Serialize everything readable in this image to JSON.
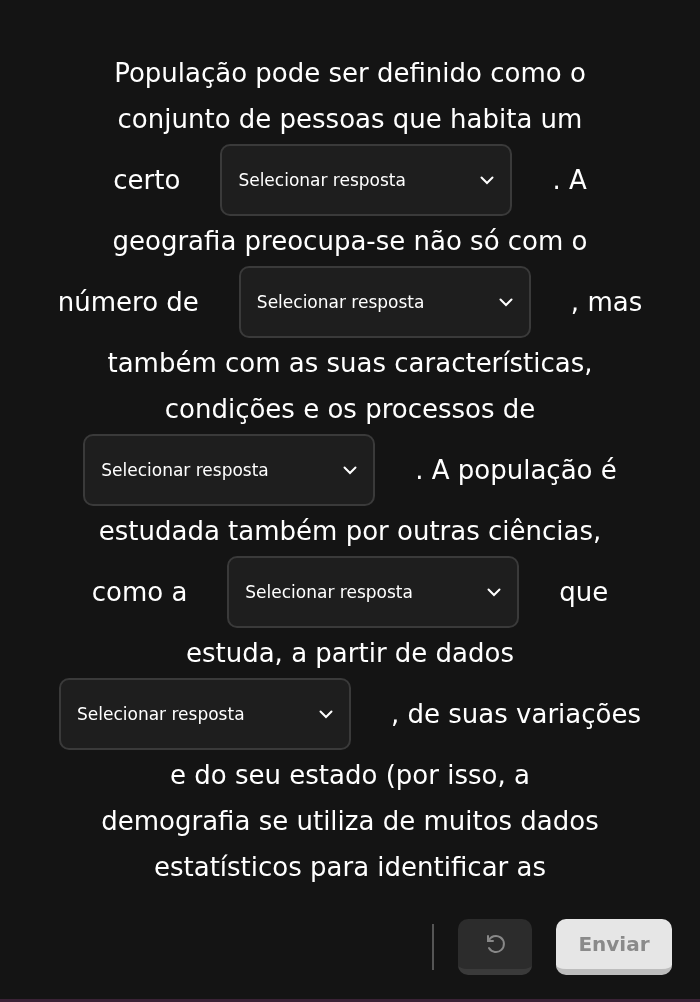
{
  "lines": [
    [
      {
        "kind": "text",
        "text": "População pode ser definido como o"
      }
    ],
    [
      {
        "kind": "text",
        "text": "conjunto de pessoas que habita um"
      }
    ],
    [
      {
        "kind": "text",
        "text": "certo"
      },
      {
        "kind": "dropdown",
        "placeholder": "Selecionar resposta"
      },
      {
        "kind": "text",
        "text": ". A"
      }
    ],
    [
      {
        "kind": "text",
        "text": "geografia preocupa-se não só com o"
      }
    ],
    [
      {
        "kind": "text",
        "text": "número de"
      },
      {
        "kind": "dropdown",
        "placeholder": "Selecionar resposta"
      },
      {
        "kind": "text",
        "text": ", mas"
      }
    ],
    [
      {
        "kind": "text",
        "text": "também com as suas características,"
      }
    ],
    [
      {
        "kind": "text",
        "text": "condições e os processos de"
      }
    ],
    [
      {
        "kind": "dropdown",
        "placeholder": "Selecionar resposta"
      },
      {
        "kind": "text",
        "text": ". A população é"
      }
    ],
    [
      {
        "kind": "text",
        "text": "estudada também por outras ciências,"
      }
    ],
    [
      {
        "kind": "text",
        "text": "como a"
      },
      {
        "kind": "dropdown",
        "placeholder": "Selecionar resposta"
      },
      {
        "kind": "text",
        "text": "que"
      }
    ],
    [
      {
        "kind": "text",
        "text": "estuda, a partir de dados"
      }
    ],
    [
      {
        "kind": "dropdown",
        "placeholder": "Selecionar resposta"
      },
      {
        "kind": "text",
        "text": ", de suas variações"
      }
    ],
    [
      {
        "kind": "text",
        "text": "e do seu estado (por isso, a"
      }
    ],
    [
      {
        "kind": "text",
        "text": "demografia se utiliza de muitos dados"
      }
    ],
    [
      {
        "kind": "text",
        "text": "estatísticos para identificar as"
      }
    ]
  ],
  "submit": {
    "label": "Enviar",
    "disabled": true
  }
}
